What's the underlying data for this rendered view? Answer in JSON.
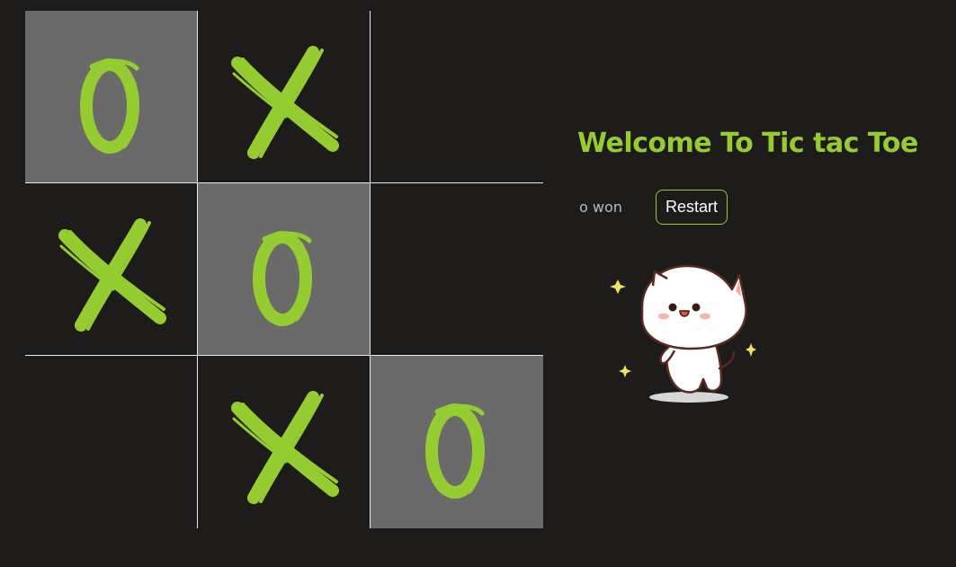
{
  "game": {
    "title": "Welcome To Tic tac Toe",
    "status": "o won",
    "restart_label": "Restart",
    "board": [
      [
        "O",
        "X",
        ""
      ],
      [
        "X",
        "O",
        ""
      ],
      [
        "",
        "X",
        "O"
      ]
    ],
    "winning_cells": [
      [
        0,
        0
      ],
      [
        1,
        1
      ],
      [
        2,
        2
      ]
    ],
    "colors": {
      "background": "#1e1b1b",
      "accent": "#94cc32",
      "win_cell": "#6b6a6a",
      "grid": "#e8e8e8",
      "status_text": "#b9b9b9"
    }
  },
  "mascot": {
    "icon": "cat-icon"
  }
}
